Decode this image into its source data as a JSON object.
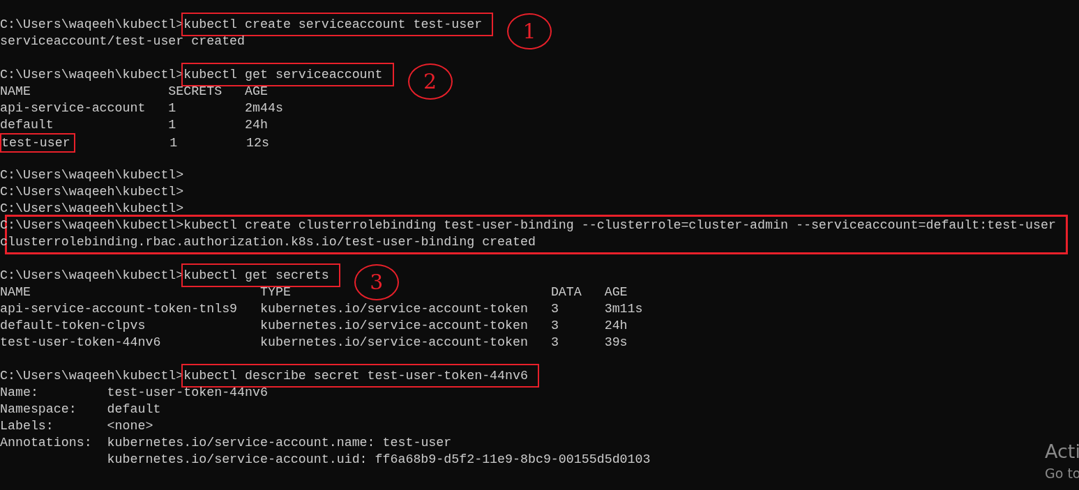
{
  "terminal": {
    "lines": [
      {
        "kind": "command",
        "prompt": "C:\\Users\\waqeeh\\kubectl>",
        "command": "kubectl create serviceaccount test-user",
        "highlighted": true,
        "callout": "1"
      },
      {
        "kind": "output",
        "text": "serviceaccount/test-user created"
      },
      {
        "kind": "blank"
      },
      {
        "kind": "command",
        "prompt": "C:\\Users\\waqeeh\\kubectl>",
        "command": "kubectl get serviceaccount",
        "highlighted": true,
        "callout": "2"
      },
      {
        "kind": "table",
        "columns": [
          "NAME",
          "SECRETS",
          "AGE"
        ],
        "rows": [
          {
            "cells": [
              "api-service-account",
              "1",
              "2m44s"
            ],
            "highlighted": false
          },
          {
            "cells": [
              "default",
              "1",
              "24h"
            ],
            "highlighted": false
          },
          {
            "cells": [
              "test-user",
              "1",
              "12s"
            ],
            "highlighted": true
          }
        ]
      },
      {
        "kind": "blank"
      },
      {
        "kind": "command",
        "prompt": "C:\\Users\\waqeeh\\kubectl>"
      },
      {
        "kind": "command",
        "prompt": "C:\\Users\\waqeeh\\kubectl>"
      },
      {
        "kind": "command",
        "prompt": "C:\\Users\\waqeeh\\kubectl>"
      },
      {
        "kind": "group",
        "highlighted": true,
        "lines": [
          {
            "kind": "command",
            "prompt": "C:\\Users\\waqeeh\\kubectl>",
            "command": "kubectl create clusterrolebinding test-user-binding --clusterrole=cluster-admin --serviceaccount=default:test-user",
            "highlighted": false
          },
          {
            "kind": "output",
            "text": "clusterrolebinding.rbac.authorization.k8s.io/test-user-binding created"
          }
        ]
      },
      {
        "kind": "blank"
      },
      {
        "kind": "command",
        "prompt": "C:\\Users\\waqeeh\\kubectl>",
        "command": "kubectl get secrets",
        "highlighted": true,
        "callout": "3"
      },
      {
        "kind": "table",
        "columns": [
          "NAME",
          "TYPE",
          "DATA",
          "AGE"
        ],
        "rows": [
          {
            "cells": [
              "api-service-account-token-tnls9",
              "kubernetes.io/service-account-token",
              "3",
              "3m11s"
            ],
            "highlighted": false
          },
          {
            "cells": [
              "default-token-clpvs",
              "kubernetes.io/service-account-token",
              "3",
              "24h"
            ],
            "highlighted": false
          },
          {
            "cells": [
              "test-user-token-44nv6",
              "kubernetes.io/service-account-token",
              "3",
              "39s"
            ],
            "highlighted": false
          }
        ]
      },
      {
        "kind": "blank"
      },
      {
        "kind": "command",
        "prompt": "C:\\Users\\waqeeh\\kubectl>",
        "command": "kubectl describe secret test-user-token-44nv6",
        "highlighted": true
      },
      {
        "kind": "fields",
        "fields": [
          {
            "key": "Name:",
            "values": [
              "test-user-token-44nv6"
            ]
          },
          {
            "key": "Namespace:",
            "values": [
              "default"
            ]
          },
          {
            "key": "Labels:",
            "values": [
              "<none>"
            ]
          },
          {
            "key": "Annotations:",
            "values": [
              "kubernetes.io/service-account.name: test-user",
              "kubernetes.io/service-account.uid: ff6a68b9-d5f2-11e9-8bc9-00155d5d0103"
            ]
          }
        ]
      }
    ]
  },
  "os_notice": {
    "lines": [
      "Acti",
      "Go to"
    ]
  }
}
